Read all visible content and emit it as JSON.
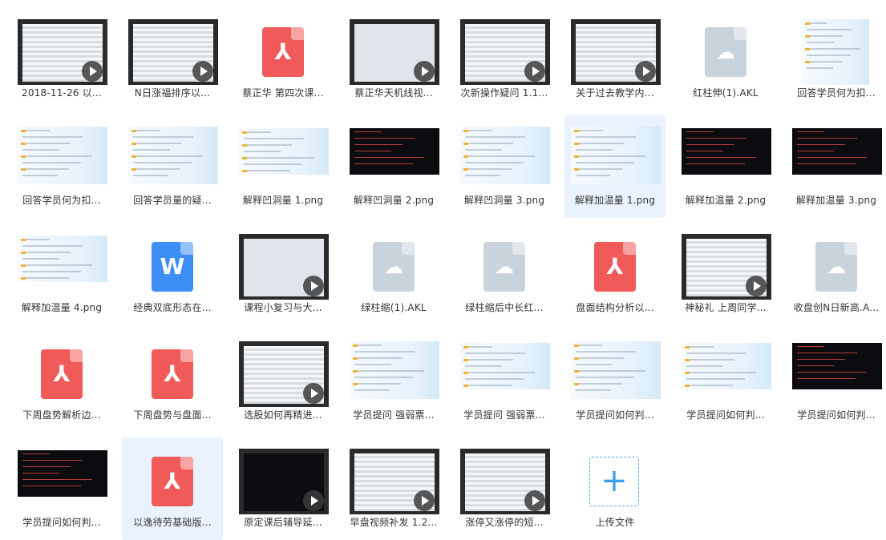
{
  "files": [
    {
      "name": "2018-11-26 以...",
      "type": "video",
      "style": "grid"
    },
    {
      "name": "N日涨福排序以...",
      "type": "video",
      "style": "grid"
    },
    {
      "name": "蔡正华 第四次课...",
      "type": "pdf"
    },
    {
      "name": "蔡正华天机线视...",
      "type": "video",
      "style": "light"
    },
    {
      "name": "次新操作疑问 1.1...",
      "type": "video",
      "style": "grid"
    },
    {
      "name": "关于过去教学内...",
      "type": "video",
      "style": "grid"
    },
    {
      "name": "红柱伸(1).AKL",
      "type": "akl"
    },
    {
      "name": "回答学员何为扣...",
      "type": "image",
      "style": "tall"
    },
    {
      "name": "回答学员何为扣...",
      "type": "image",
      "style": "mid"
    },
    {
      "name": "回答学员量的疑...",
      "type": "image",
      "style": "mid"
    },
    {
      "name": "解释凹洞量 1.png",
      "type": "image",
      "style": "wide"
    },
    {
      "name": "解释凹洞量 2.png",
      "type": "image",
      "style": "chart"
    },
    {
      "name": "解释凹洞量 3.png",
      "type": "image",
      "style": "mid"
    },
    {
      "name": "解释加温量 1.png",
      "type": "image",
      "style": "mid",
      "selected": true
    },
    {
      "name": "解释加温量 2.png",
      "type": "image",
      "style": "chart"
    },
    {
      "name": "解释加温量 3.png",
      "type": "image",
      "style": "chart"
    },
    {
      "name": "解释加温量 4.png",
      "type": "image",
      "style": "wide"
    },
    {
      "name": "经典双底形态在...",
      "type": "doc"
    },
    {
      "name": "课程小复习与大...",
      "type": "video",
      "style": "light"
    },
    {
      "name": "绿柱缩(1).AKL",
      "type": "akl"
    },
    {
      "name": "绿柱缩后中长红...",
      "type": "akl"
    },
    {
      "name": "盘面结构分析以...",
      "type": "pdf"
    },
    {
      "name": "神秘礼 上周同学...",
      "type": "video",
      "style": "grid"
    },
    {
      "name": "收盘创N日新高.A...",
      "type": "akl"
    },
    {
      "name": "下周盘势解析边...",
      "type": "pdf"
    },
    {
      "name": "下周盘势与盘面...",
      "type": "pdf"
    },
    {
      "name": "选股如何再精进...",
      "type": "video",
      "style": "grid"
    },
    {
      "name": "学员提问 强弱票...",
      "type": "image",
      "style": "mid"
    },
    {
      "name": "学员提问 强弱票...",
      "type": "image",
      "style": "wide"
    },
    {
      "name": "学员提问如何判...",
      "type": "image",
      "style": "mid"
    },
    {
      "name": "学员提问如何判...",
      "type": "image",
      "style": "wide"
    },
    {
      "name": "学员提问如何判...",
      "type": "image",
      "style": "chart"
    },
    {
      "name": "学员提问如何判...",
      "type": "image",
      "style": "chart"
    },
    {
      "name": "以逸待劳基础版...",
      "type": "pdf",
      "selected": true
    },
    {
      "name": "原定课后辅导延...",
      "type": "video",
      "style": "dark"
    },
    {
      "name": "早盘视频补发 1.2...",
      "type": "video",
      "style": "grid"
    },
    {
      "name": "涨停又涨停的短...",
      "type": "video",
      "style": "grid"
    },
    {
      "name": "上传文件",
      "type": "upload"
    }
  ],
  "icons": {
    "pdf": "pdf-icon",
    "doc": "word-document-icon",
    "akl": "cloud-file-icon",
    "video": "play-icon",
    "upload": "plus-icon"
  },
  "glyphs": {
    "pdf": "⅄",
    "doc": "W",
    "akl": "☁",
    "upload": "+"
  },
  "colors": {
    "pdf": "#f05a58",
    "doc": "#3e8ef7",
    "akl": "#c9d3dc",
    "accent": "#3d9be9",
    "selected": "#eaf3fd"
  }
}
